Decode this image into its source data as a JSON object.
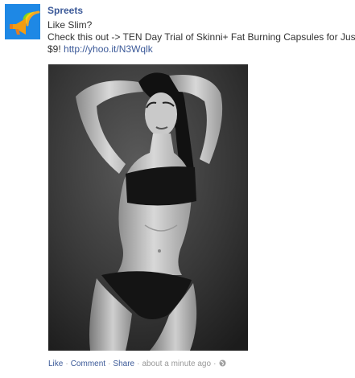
{
  "post": {
    "author": "Spreets",
    "message_line1": "Like Slim?",
    "message_line2": "Check this out -> TEN Day Trial of Skinni+ Fat Burning Capsules for Just",
    "message_line3_prefix": "$9! ",
    "link_text": "http://yhoo.it/N3Wqlk",
    "avatar_icon": "megaphone-logo-icon",
    "photo_description_icon": "photo",
    "actions": {
      "like": "Like",
      "comment": "Comment",
      "share": "Share",
      "separator": "·",
      "timestamp": "about a minute ago",
      "privacy_icon": "globe-icon"
    },
    "colors": {
      "link": "#3b5998",
      "avatar_bg": "#1e88e5",
      "meta": "#999999"
    }
  }
}
